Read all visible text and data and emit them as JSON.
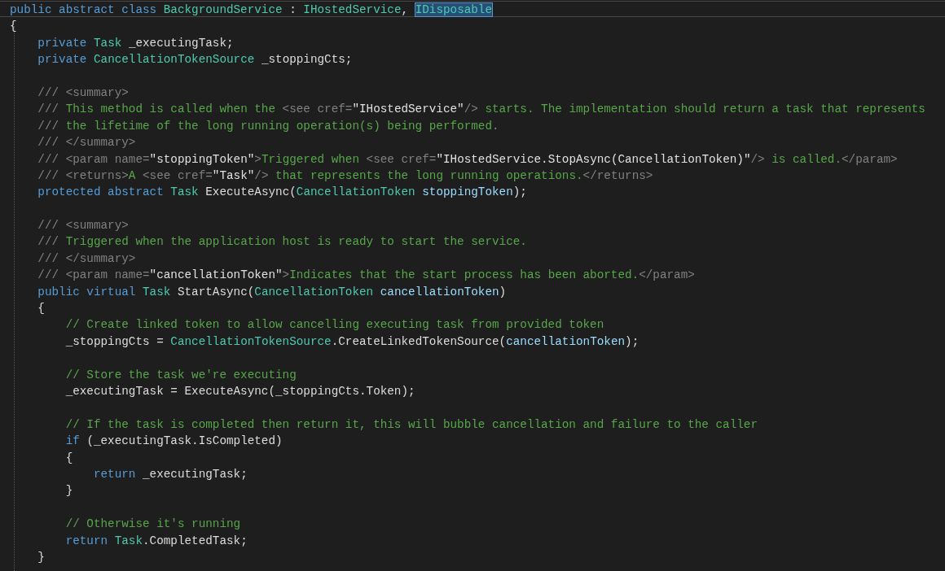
{
  "editor": {
    "lines": [
      {
        "current": true,
        "tokens": [
          {
            "kind": "kw",
            "text": "public abstract class "
          },
          {
            "kind": "type",
            "text": "BackgroundService"
          },
          {
            "kind": "plain",
            "text": " : "
          },
          {
            "kind": "type",
            "text": "IHostedService"
          },
          {
            "kind": "plain",
            "text": ", "
          },
          {
            "kind": "highlight",
            "text": "IDisposable"
          }
        ]
      },
      {
        "current": false,
        "tokens": [
          {
            "kind": "plain",
            "text": "{"
          }
        ]
      },
      {
        "current": false,
        "tokens": [
          {
            "kind": "kw",
            "text": "    private "
          },
          {
            "kind": "type",
            "text": "Task"
          },
          {
            "kind": "plain",
            "text": " _executingTask;"
          }
        ]
      },
      {
        "current": false,
        "tokens": [
          {
            "kind": "kw",
            "text": "    private "
          },
          {
            "kind": "type",
            "text": "CancellationTokenSource"
          },
          {
            "kind": "plain",
            "text": " _stoppingCts;"
          }
        ]
      },
      {
        "current": false
      },
      {
        "current": false,
        "tokens": [
          {
            "kind": "doctag",
            "text": "    /// <summary>"
          }
        ]
      },
      {
        "current": false,
        "tokens": [
          {
            "kind": "doctag",
            "text": "    ///"
          },
          {
            "kind": "doctext",
            "text": " This method is called when the "
          },
          {
            "kind": "doctag",
            "text": "<see cref="
          },
          {
            "kind": "docattr",
            "text": "\"IHostedService\""
          },
          {
            "kind": "doctag",
            "text": "/>"
          },
          {
            "kind": "doctext",
            "text": " starts. The implementation should return a task that represents"
          }
        ]
      },
      {
        "current": false,
        "tokens": [
          {
            "kind": "doctag",
            "text": "    ///"
          },
          {
            "kind": "doctext",
            "text": " the lifetime of the long running operation(s) being performed."
          }
        ]
      },
      {
        "current": false,
        "tokens": [
          {
            "kind": "doctag",
            "text": "    /// </summary>"
          }
        ]
      },
      {
        "current": false,
        "tokens": [
          {
            "kind": "doctag",
            "text": "    /// <param name="
          },
          {
            "kind": "docattr",
            "text": "\"stoppingToken\""
          },
          {
            "kind": "doctag",
            "text": ">"
          },
          {
            "kind": "doctext",
            "text": "Triggered when "
          },
          {
            "kind": "doctag",
            "text": "<see cref="
          },
          {
            "kind": "docattr",
            "text": "\"IHostedService.StopAsync(CancellationToken)\""
          },
          {
            "kind": "doctag",
            "text": "/>"
          },
          {
            "kind": "doctext",
            "text": " is called."
          },
          {
            "kind": "doctag",
            "text": "</param>"
          }
        ]
      },
      {
        "current": false,
        "tokens": [
          {
            "kind": "doctag",
            "text": "    /// <returns>"
          },
          {
            "kind": "doctext",
            "text": "A "
          },
          {
            "kind": "doctag",
            "text": "<see cref="
          },
          {
            "kind": "docattr",
            "text": "\"Task\""
          },
          {
            "kind": "doctag",
            "text": "/>"
          },
          {
            "kind": "doctext",
            "text": " that represents the long running operations."
          },
          {
            "kind": "doctag",
            "text": "</returns>"
          }
        ]
      },
      {
        "current": false,
        "tokens": [
          {
            "kind": "kw",
            "text": "    protected abstract "
          },
          {
            "kind": "type",
            "text": "Task"
          },
          {
            "kind": "plain",
            "text": " ExecuteAsync("
          },
          {
            "kind": "type",
            "text": "CancellationToken"
          },
          {
            "kind": "param",
            "text": " stoppingToken"
          },
          {
            "kind": "plain",
            "text": ");"
          }
        ]
      },
      {
        "current": false
      },
      {
        "current": false,
        "tokens": [
          {
            "kind": "doctag",
            "text": "    /// <summary>"
          }
        ]
      },
      {
        "current": false,
        "tokens": [
          {
            "kind": "doctag",
            "text": "    ///"
          },
          {
            "kind": "doctext",
            "text": " Triggered when the application host is ready to start the service."
          }
        ]
      },
      {
        "current": false,
        "tokens": [
          {
            "kind": "doctag",
            "text": "    /// </summary>"
          }
        ]
      },
      {
        "current": false,
        "tokens": [
          {
            "kind": "doctag",
            "text": "    /// <param name="
          },
          {
            "kind": "docattr",
            "text": "\"cancellationToken\""
          },
          {
            "kind": "doctag",
            "text": ">"
          },
          {
            "kind": "doctext",
            "text": "Indicates that the start process has been aborted."
          },
          {
            "kind": "doctag",
            "text": "</param>"
          }
        ]
      },
      {
        "current": false,
        "tokens": [
          {
            "kind": "kw",
            "text": "    public virtual "
          },
          {
            "kind": "type",
            "text": "Task"
          },
          {
            "kind": "plain",
            "text": " StartAsync("
          },
          {
            "kind": "type",
            "text": "CancellationToken"
          },
          {
            "kind": "param",
            "text": " cancellationToken"
          },
          {
            "kind": "plain",
            "text": ")"
          }
        ]
      },
      {
        "current": false,
        "tokens": [
          {
            "kind": "plain",
            "text": "    {"
          }
        ]
      },
      {
        "current": false,
        "tokens": [
          {
            "kind": "comment",
            "text": "        // Create linked token to allow cancelling executing task from provided token"
          }
        ]
      },
      {
        "current": false,
        "tokens": [
          {
            "kind": "plain",
            "text": "        _stoppingCts = "
          },
          {
            "kind": "type",
            "text": "CancellationTokenSource"
          },
          {
            "kind": "plain",
            "text": ".CreateLinkedTokenSource("
          },
          {
            "kind": "param",
            "text": "cancellationToken"
          },
          {
            "kind": "plain",
            "text": ");"
          }
        ]
      },
      {
        "current": false
      },
      {
        "current": false,
        "tokens": [
          {
            "kind": "comment",
            "text": "        // Store the task we're executing"
          }
        ]
      },
      {
        "current": false,
        "tokens": [
          {
            "kind": "plain",
            "text": "        _executingTask = ExecuteAsync(_stoppingCts.Token);"
          }
        ]
      },
      {
        "current": false
      },
      {
        "current": false,
        "tokens": [
          {
            "kind": "comment",
            "text": "        // If the task is completed then return it, this will bubble cancellation and failure to the caller"
          }
        ]
      },
      {
        "current": false,
        "tokens": [
          {
            "kind": "kw",
            "text": "        if"
          },
          {
            "kind": "plain",
            "text": " (_executingTask.IsCompleted)"
          }
        ]
      },
      {
        "current": false,
        "tokens": [
          {
            "kind": "plain",
            "text": "        {"
          }
        ]
      },
      {
        "current": false,
        "tokens": [
          {
            "kind": "kw",
            "text": "            return"
          },
          {
            "kind": "plain",
            "text": " _executingTask;"
          }
        ]
      },
      {
        "current": false,
        "tokens": [
          {
            "kind": "plain",
            "text": "        }"
          }
        ]
      },
      {
        "current": false
      },
      {
        "current": false,
        "tokens": [
          {
            "kind": "comment",
            "text": "        // Otherwise it's running"
          }
        ]
      },
      {
        "current": false,
        "tokens": [
          {
            "kind": "kw",
            "text": "        return "
          },
          {
            "kind": "type",
            "text": "Task"
          },
          {
            "kind": "plain",
            "text": ".CompletedTask;"
          }
        ]
      },
      {
        "current": false,
        "tokens": [
          {
            "kind": "plain",
            "text": "    }"
          }
        ]
      }
    ]
  }
}
